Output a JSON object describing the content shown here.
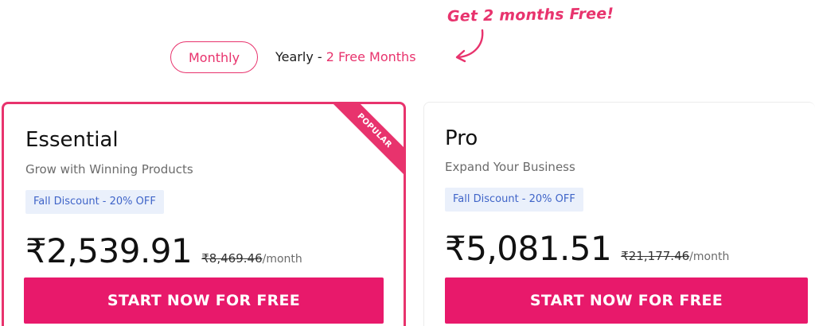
{
  "billing_toggle": {
    "monthly_label": "Monthly",
    "yearly_label": "Yearly - ",
    "yearly_highlight": "2 Free Months",
    "promo_callout": "Get 2 months Free!"
  },
  "plans": [
    {
      "name": "Essential",
      "subtitle": "Grow with Winning Products",
      "discount_badge": "Fall Discount - 20% OFF",
      "price": "₹2,539.91",
      "original_price": "₹8,469.46",
      "period": "/month",
      "cta_label": "START NOW FOR FREE",
      "ribbon_label": "POPULAR"
    },
    {
      "name": "Pro",
      "subtitle": "Expand Your Business",
      "discount_badge": "Fall Discount - 20% OFF",
      "price": "₹5,081.51",
      "original_price": "₹21,177.46",
      "period": "/month",
      "cta_label": "START NOW FOR FREE"
    }
  ],
  "colors": {
    "accent": "#e8336d",
    "cta": "#e8196b",
    "badge_bg": "#eaf0fb",
    "badge_text": "#3f64c8"
  },
  "icons": {
    "promo_arrow": "curved-arrow-icon"
  }
}
